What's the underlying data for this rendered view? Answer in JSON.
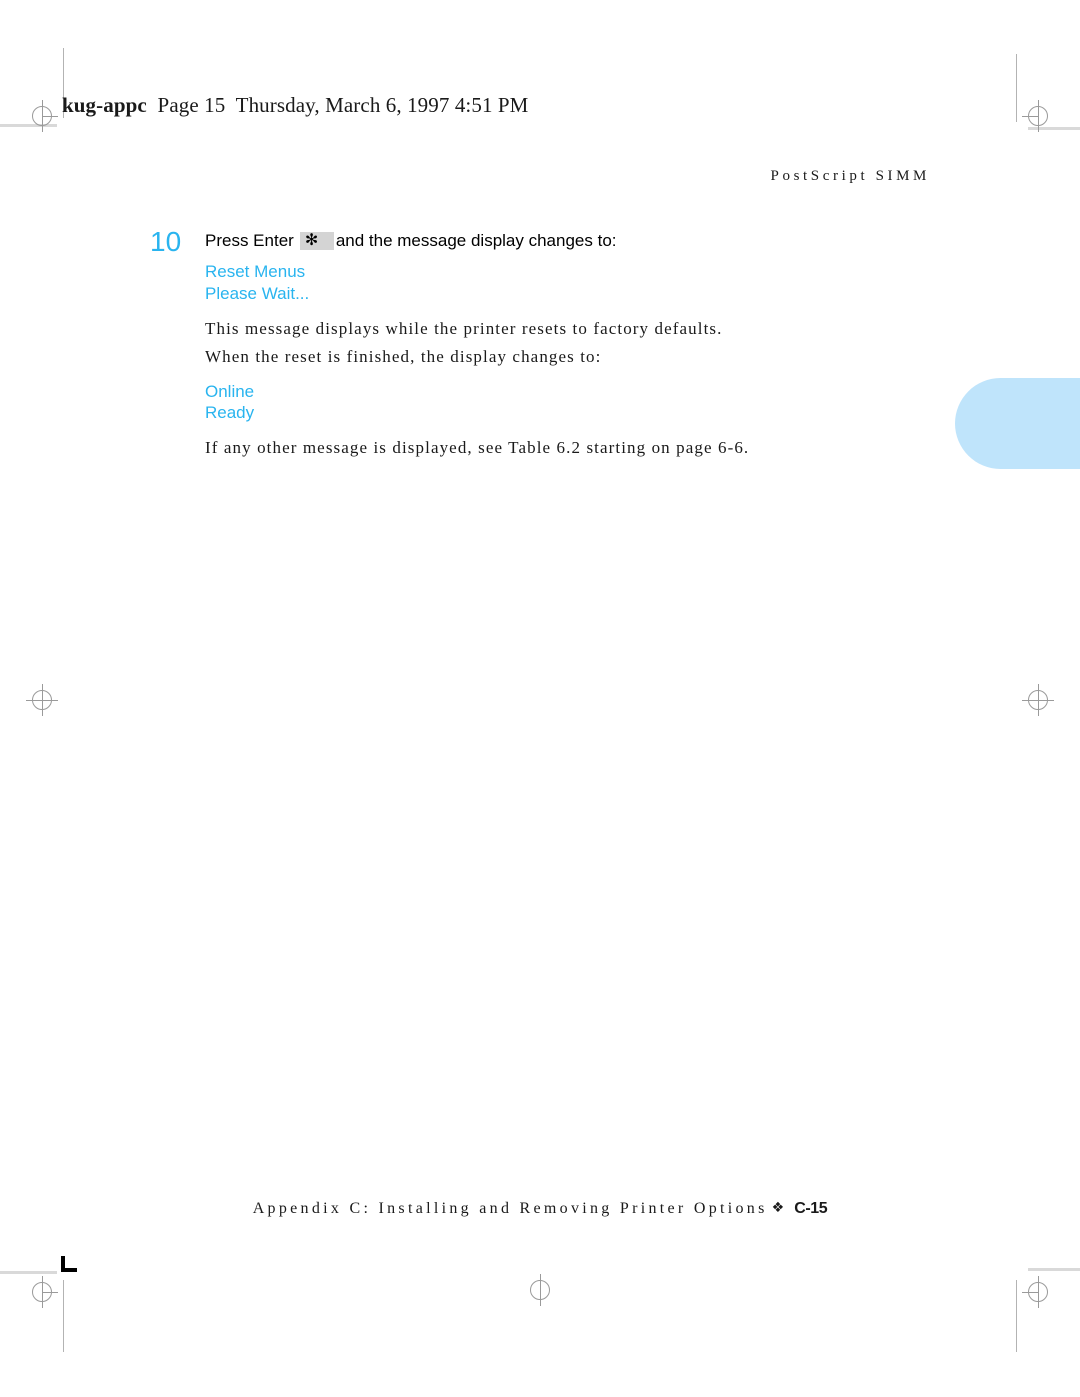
{
  "slug": {
    "file_name": "kug-appc",
    "page_label": "Page 15",
    "timestamp": "Thursday, March 6, 1997  4:51 PM"
  },
  "running_head": {
    "title": "PostScript SIMM"
  },
  "step": {
    "number": "10",
    "lead_before_key": "Press Enter",
    "key_cap_glyph": "✻",
    "lead_after_key": "and the message display changes to:",
    "lcd_first": [
      "Reset Menus",
      "Please Wait..."
    ],
    "paragraph_1": "This message displays while the printer resets to factory defaults.",
    "paragraph_2": "When the reset is finished, the display changes to:",
    "lcd_second": [
      "Online",
      "Ready"
    ],
    "paragraph_3": "If any other message is displayed, see Table 6.2 starting on page 6-6."
  },
  "footer": {
    "chapter_text": "Appendix C: Installing and Removing Printer Options",
    "ornament": "❖",
    "folio": "C-15"
  },
  "colors": {
    "accent_cyan": "#29b4ef",
    "tab_blue": "#bfe4fb",
    "key_cap_gray": "#d4d4d4",
    "mark_gray": "#9a9a9a"
  }
}
